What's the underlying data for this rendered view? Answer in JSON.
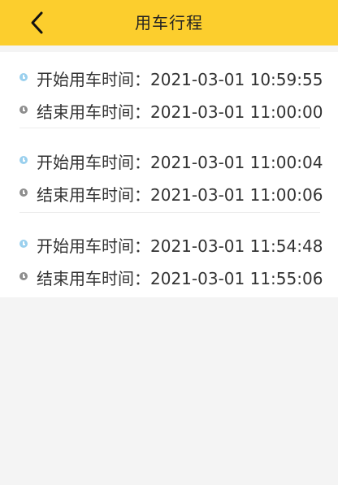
{
  "header": {
    "title": "用车行程",
    "back_icon": "chevron-left-icon",
    "background_color": "#fcce2d"
  },
  "trips": [
    {
      "start_label": "开始用车时间：",
      "start_time": "2021-03-01 10:59:55",
      "end_label": "结束用车时间：",
      "end_time": "2021-03-01 11:00:00"
    },
    {
      "start_label": "开始用车时间：",
      "start_time": "2021-03-01 11:00:04",
      "end_label": "结束用车时间：",
      "end_time": "2021-03-01 11:00:06"
    },
    {
      "start_label": "开始用车时间：",
      "start_time": "2021-03-01 11:54:48",
      "end_label": "结束用车时间：",
      "end_time": "2021-03-01 11:55:06"
    }
  ],
  "icons": {
    "start": "clock-icon-blue",
    "end": "clock-icon-gray"
  }
}
